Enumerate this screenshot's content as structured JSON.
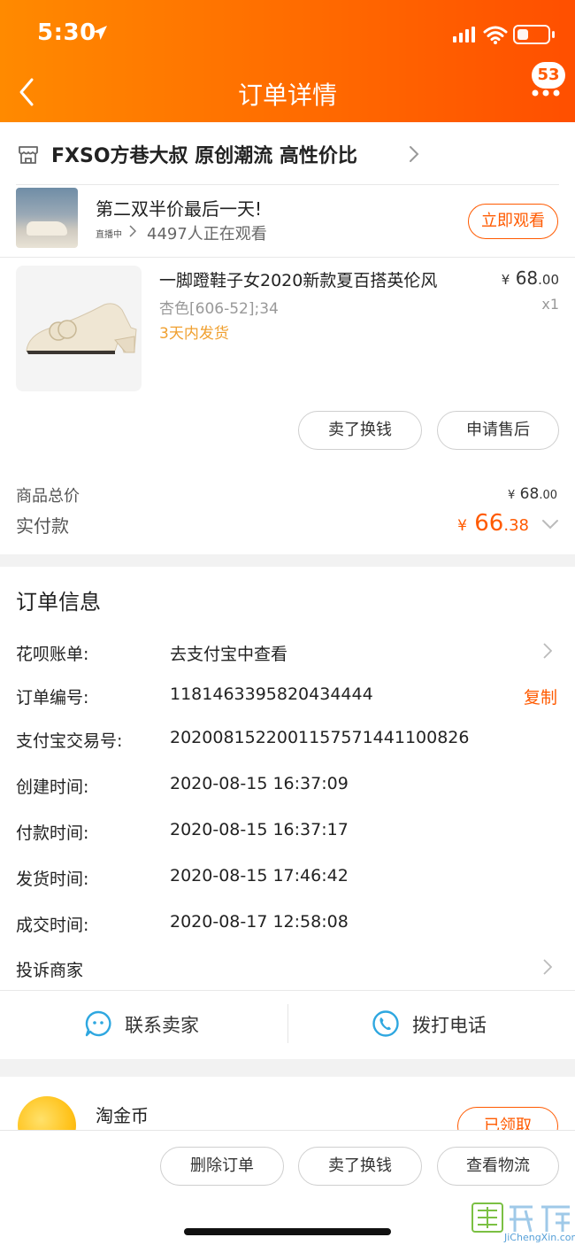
{
  "status_bar": {
    "time": "5:30"
  },
  "nav": {
    "title": "订单详情",
    "badge_count": "53"
  },
  "store": {
    "name": "FXSO方巷大叔 原创潮流 高性价比"
  },
  "live": {
    "title": "第二双半价最后一天!",
    "tag": "直播中",
    "viewers": "4497人正在观看",
    "watch_button": "立即观看"
  },
  "product": {
    "name": "一脚蹬鞋子女2020新款夏百搭英伦风",
    "sku": "杏色[606-52];34",
    "ship_note": "3天内发货",
    "price_symbol": "¥",
    "price_int": "68",
    "price_dec": ".00",
    "qty": "x1",
    "btn_sell": "卖了换钱",
    "btn_aftersale": "申请售后"
  },
  "summary": {
    "total_label": "商品总价",
    "total_symbol": "¥",
    "total_int": "68",
    "total_dec": ".00",
    "paid_label": "实付款",
    "paid_symbol": "¥",
    "paid_int": "66",
    "paid_dec": ".38"
  },
  "order_info": {
    "section_title": "订单信息",
    "rows": [
      {
        "label": "花呗账单:",
        "value": "去支付宝中查看"
      },
      {
        "label": "订单编号:",
        "value": "1181463395820434444"
      },
      {
        "label": "支付宝交易号:",
        "value": "2020081522001157571441100826"
      },
      {
        "label": "创建时间:",
        "value": "2020-08-15 16:37:09"
      },
      {
        "label": "付款时间:",
        "value": "2020-08-15 16:37:17"
      },
      {
        "label": "发货时间:",
        "value": "2020-08-15 17:46:42"
      },
      {
        "label": "成交时间:",
        "value": "2020-08-17 12:58:08"
      }
    ],
    "copy_label": "复制",
    "complain_label": "投诉商家",
    "contact_seller": "联系卖家",
    "call_phone": "拨打电话"
  },
  "coins": {
    "title": "淘金币",
    "received_label": "已领取"
  },
  "bottom_bar": {
    "delete_order": "删除订单",
    "sell": "卖了换钱",
    "view_logistics": "查看物流"
  },
  "watermark": {
    "text": "JiChengXin.com"
  },
  "colors": {
    "accent": "#ff5a00",
    "header_start": "#ff8a00",
    "header_end": "#ff4f00",
    "ship_note": "#f0a030",
    "link_blue": "#2ea7e0"
  }
}
